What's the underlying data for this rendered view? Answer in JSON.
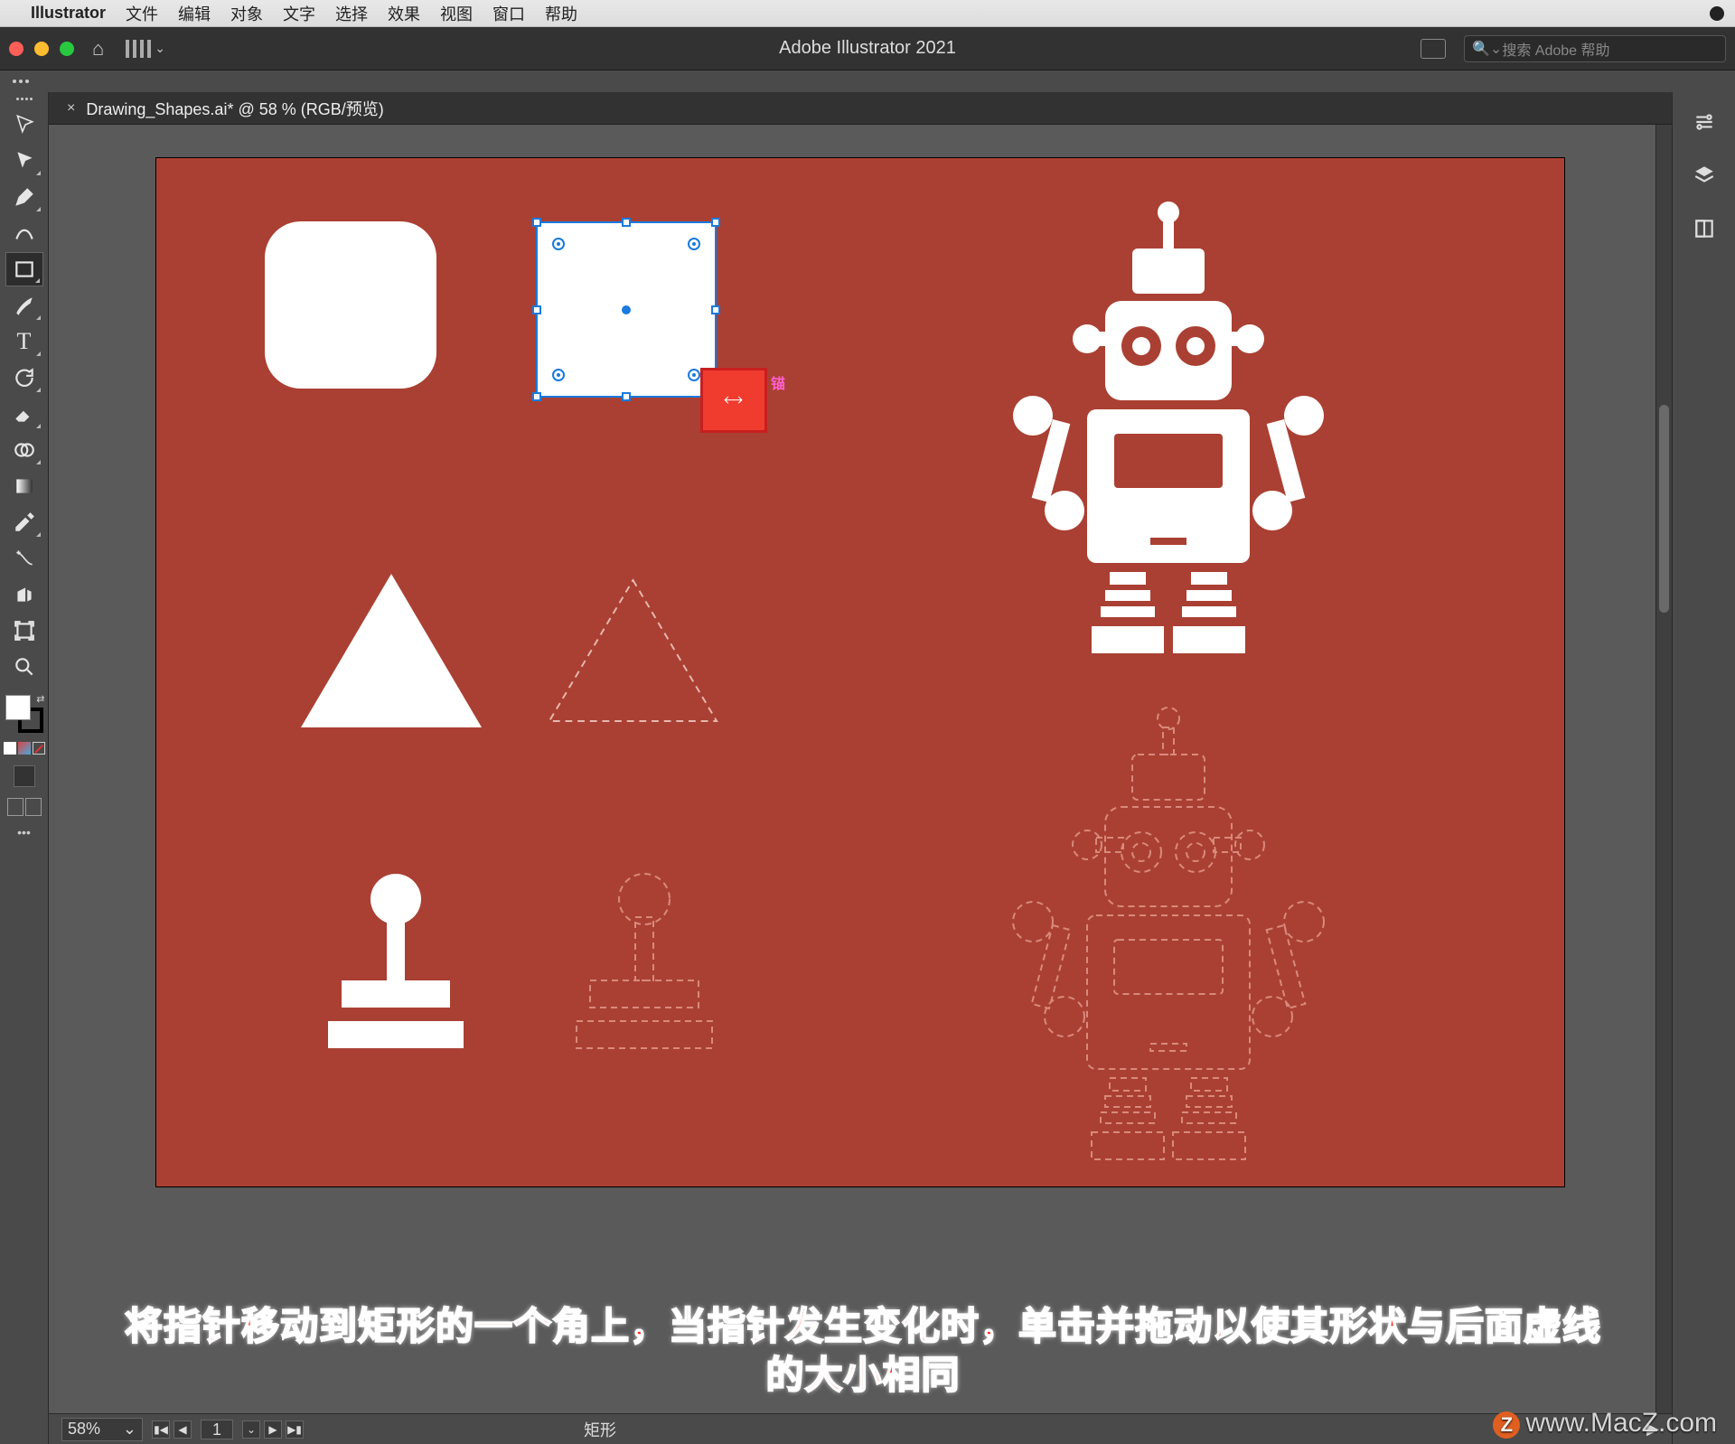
{
  "mac_menu": {
    "app_name": "Illustrator",
    "file": "文件",
    "edit": "编辑",
    "object": "对象",
    "text": "文字",
    "select": "选择",
    "effect": "效果",
    "view": "视图",
    "window": "窗口",
    "help": "帮助"
  },
  "topbar": {
    "title": "Adobe Illustrator 2021",
    "search_placeholder": "搜索 Adobe 帮助"
  },
  "tab": {
    "close": "×",
    "title": "Drawing_Shapes.ai* @ 58 % (RGB/预览)"
  },
  "cursor_label": "锚",
  "status": {
    "zoom": "58%",
    "artboard": "1",
    "selection": "矩形",
    "prev2": "▮◀",
    "prev": "◀",
    "next": "▶",
    "next2": "▶▮"
  },
  "annotation": {
    "line1": "将指针移动到矩形的一个角上，当指针发生变化时，单击并拖动以使其形状与后面虚线",
    "line2": "的大小相同"
  },
  "watermark": {
    "z": "Z",
    "text": "www.MacZ.com"
  },
  "colors": {
    "canvas": "#aa4033",
    "shape": "#ffffff",
    "select": "#1a7add"
  }
}
